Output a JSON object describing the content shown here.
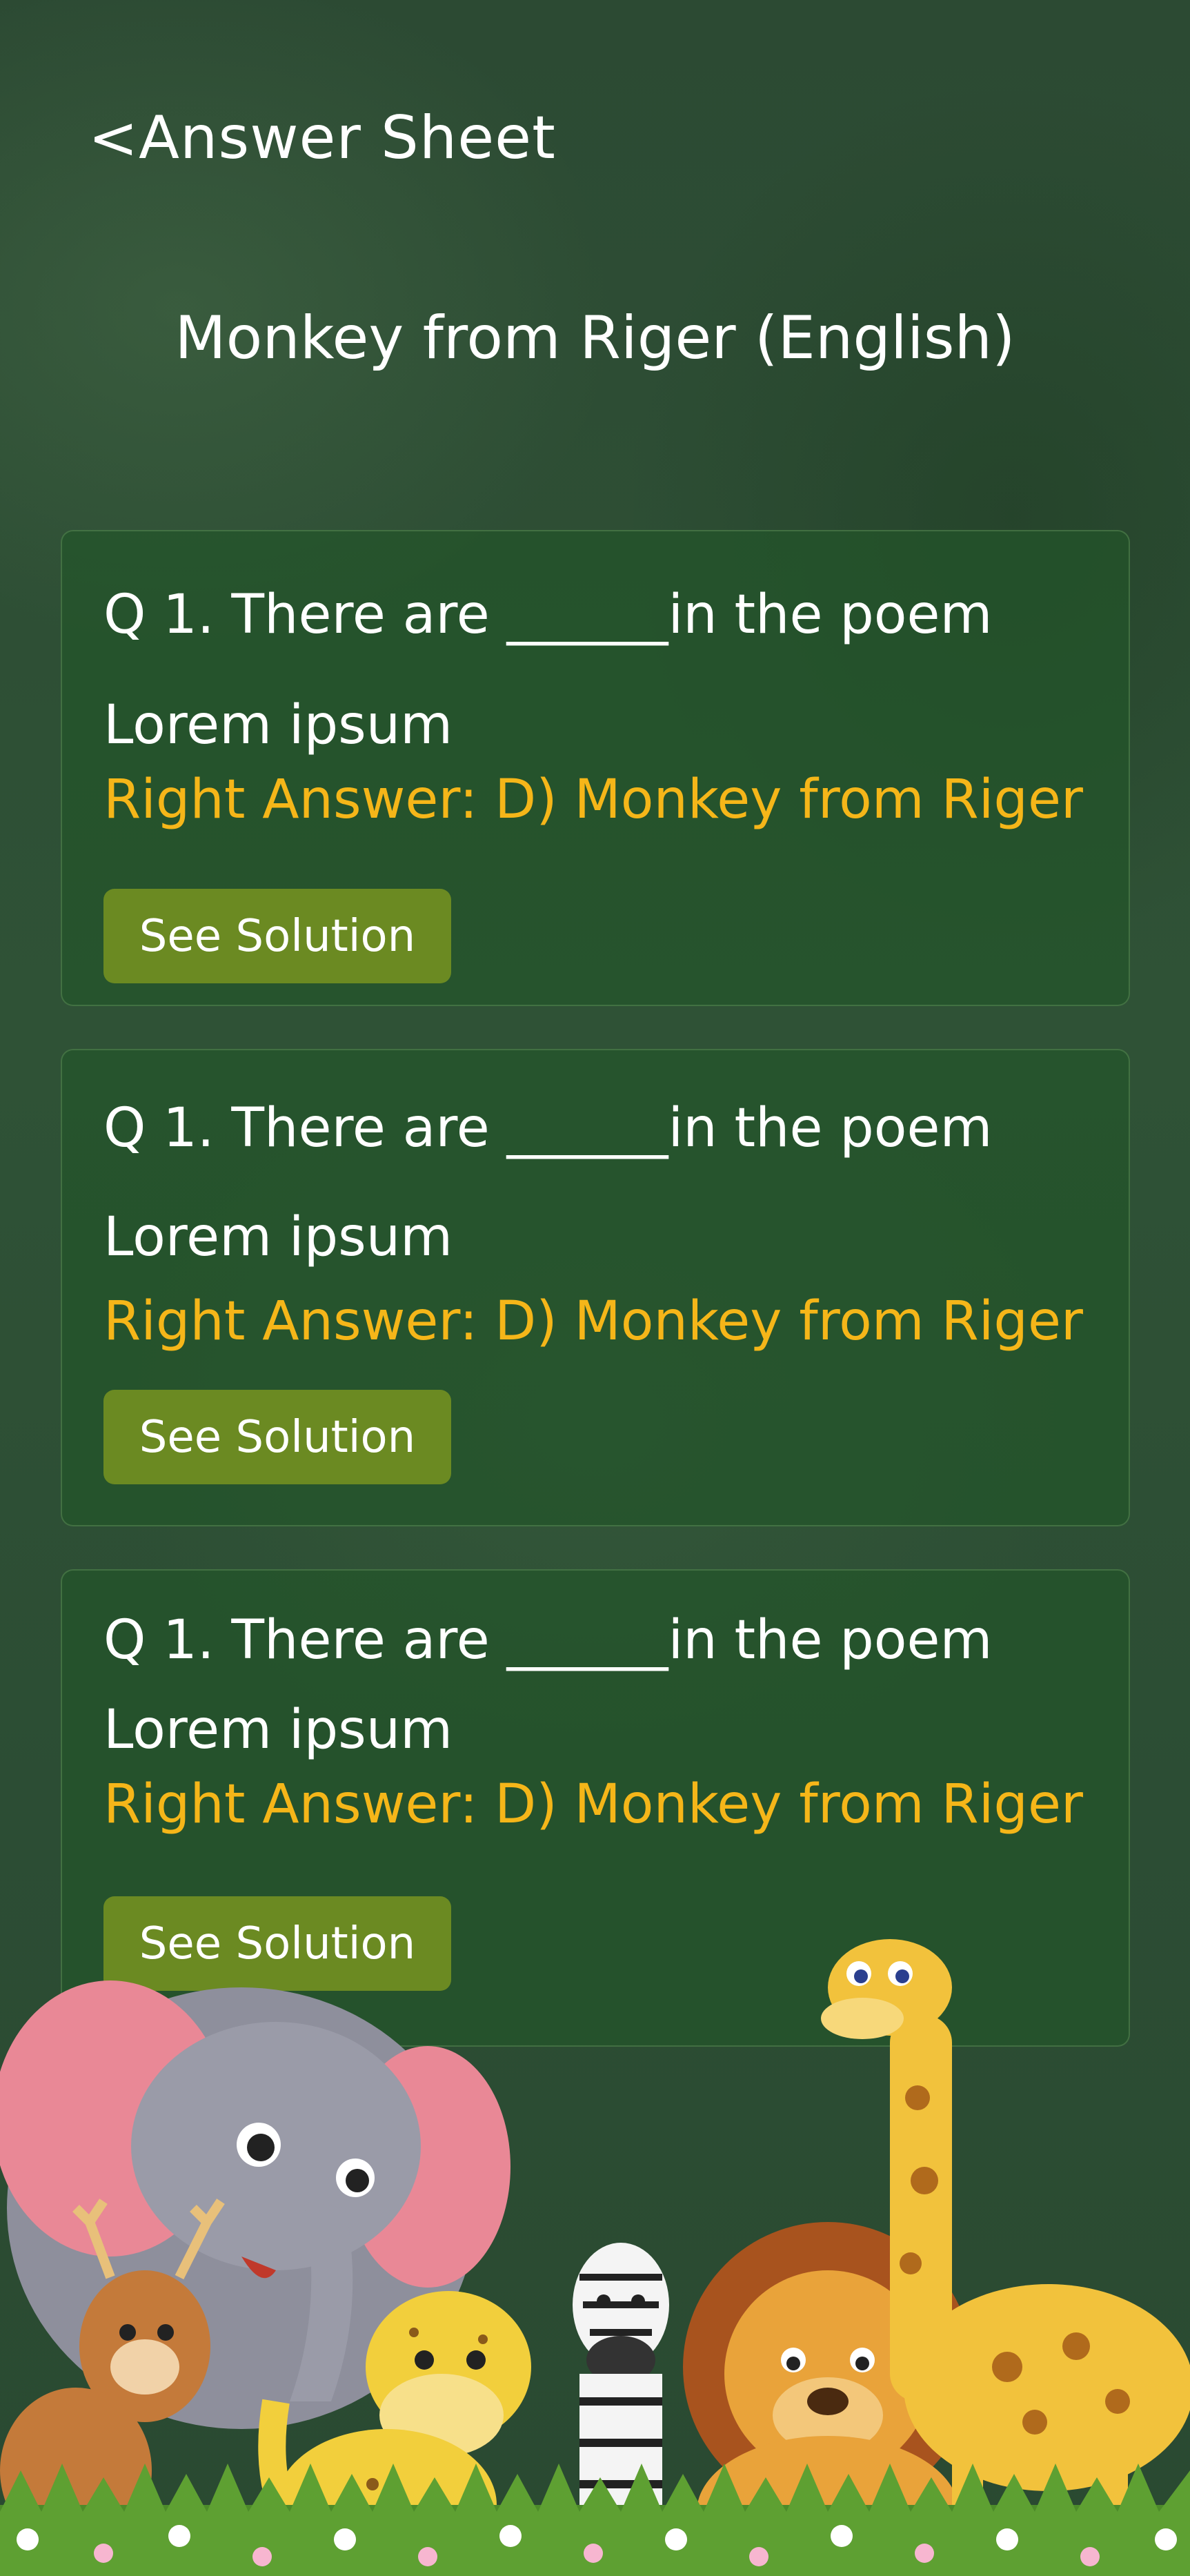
{
  "header": {
    "back_icon": "<",
    "title": "Answer Sheet"
  },
  "page_title": "Monkey from Riger (English)",
  "questions": [
    {
      "question": "Q 1. There are ______in the poem",
      "option": "Lorem ipsum",
      "right_answer": "Right Answer: D) Monkey from Riger",
      "button": "See Solution"
    },
    {
      "question": "Q 1. There are ______in the poem",
      "option": "Lorem ipsum",
      "right_answer": "Right Answer: D) Monkey from Riger",
      "button": "See Solution"
    },
    {
      "question": "Q 1. There are ______in the poem",
      "option": "Lorem ipsum",
      "right_answer": "Right Answer: D) Monkey from Riger",
      "button": "See Solution"
    }
  ],
  "colors": {
    "accent_answer": "#f5b619",
    "button": "#6b8a22",
    "background": "#2c4a33"
  },
  "illustration": [
    "elephant",
    "deer",
    "cheetah",
    "zebra",
    "lion",
    "giraffe",
    "grass",
    "flowers"
  ]
}
